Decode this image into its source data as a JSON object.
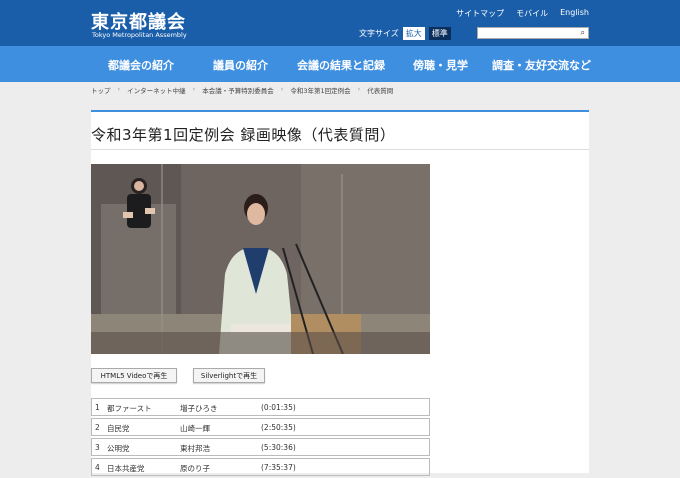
{
  "header": {
    "title": "東京都議会",
    "subtitle": "Tokyo Metropolitan Assembly",
    "toplinks": [
      "サイトマップ",
      "モバイル",
      "English"
    ],
    "fontsize_label": "文字サイズ",
    "fontsize_large": "拡大",
    "fontsize_standard": "標準"
  },
  "nav": [
    "都議会の紹介",
    "議員の紹介",
    "会議の結果と記録",
    "傍聴・見学",
    "調査・友好交流など"
  ],
  "breadcrumb": [
    "トップ",
    "インターネット中継",
    "本会議・予算特別委員会",
    "令和3年第1回定例会",
    "代表質問"
  ],
  "page": {
    "title": "令和3年第1回定例会 録画映像（代表質問）",
    "btn_html5": "HTML5 Videoで再生",
    "btn_silverlight": "Silverlightで再生"
  },
  "rows": [
    {
      "no": "1",
      "party": "都ファースト",
      "name": "増子ひろき",
      "time": "(0:01:35)"
    },
    {
      "no": "2",
      "party": "自民党",
      "name": "山崎一輝",
      "time": "(2:50:35)"
    },
    {
      "no": "3",
      "party": "公明党",
      "name": "東村邦浩",
      "time": "(5:30:36)"
    },
    {
      "no": "4",
      "party": "日本共産党",
      "name": "原のり子",
      "time": "(7:35:37)"
    }
  ],
  "colors": {
    "header": "#1a5ea9",
    "nav": "#3f8fe0",
    "accent": "#3f8fe0"
  }
}
